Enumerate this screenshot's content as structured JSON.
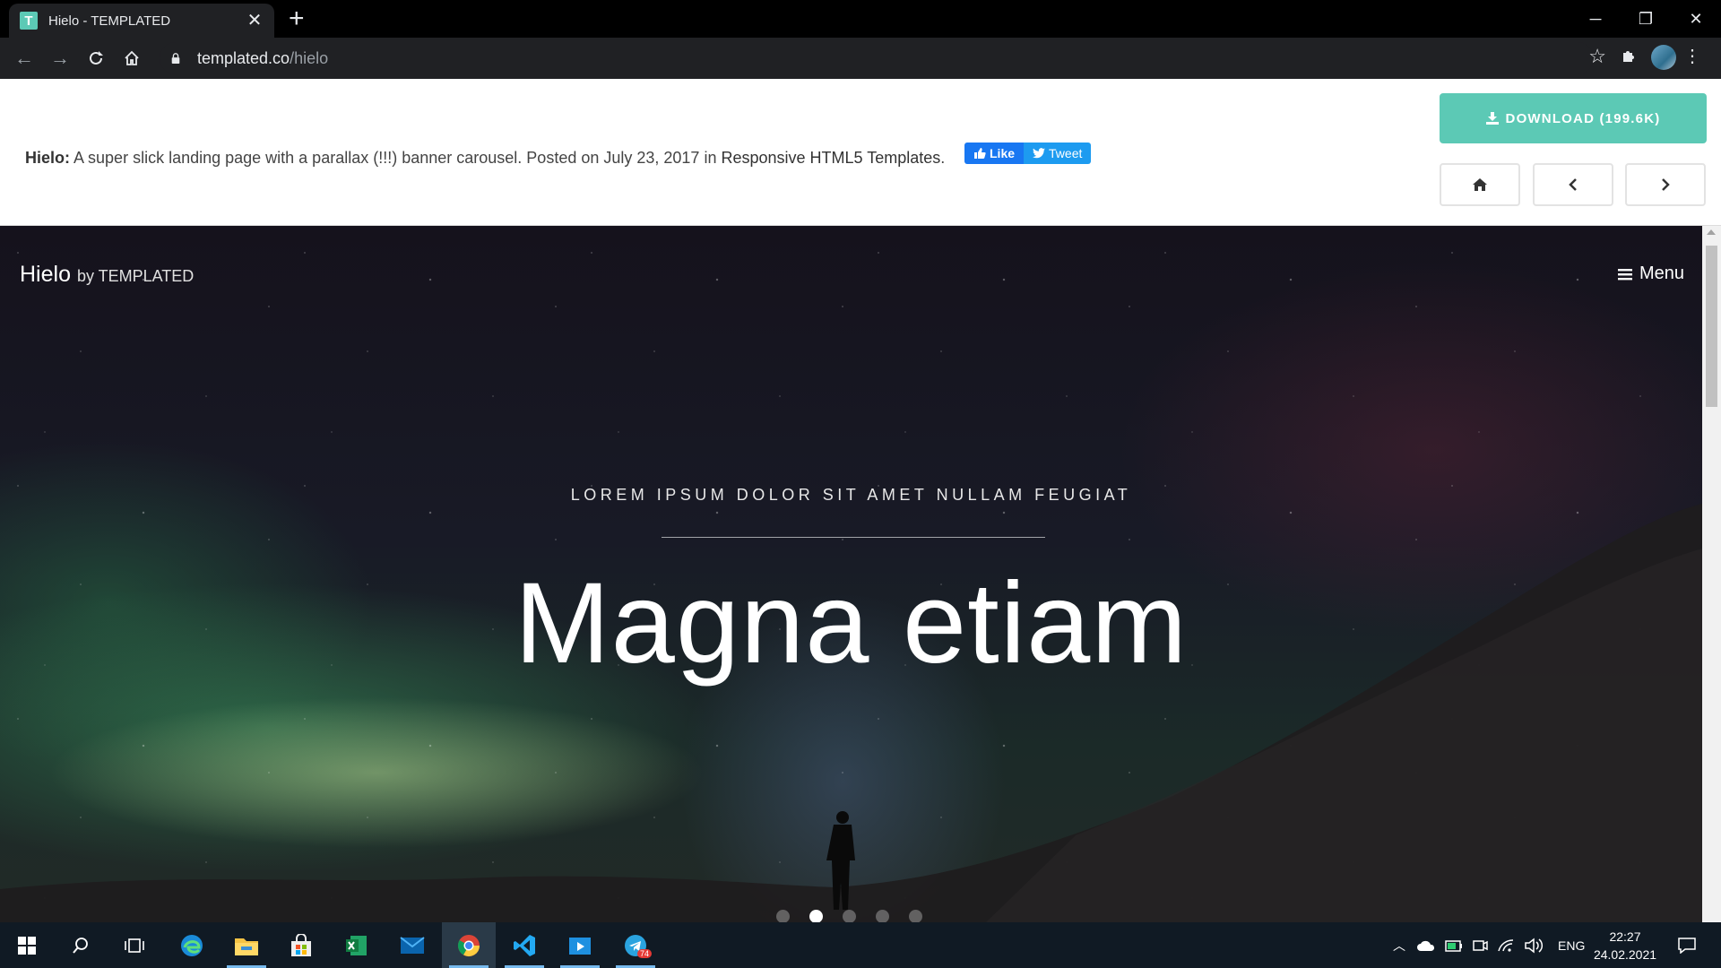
{
  "browser": {
    "tab_title": "Hielo - TEMPLATED",
    "tab_favicon_letter": "T",
    "url_host": "templated.co",
    "url_path": "/hielo"
  },
  "promo": {
    "name": "Hielo:",
    "description": " A super slick landing page with a parallax (!!!) banner carousel. Posted on July 23, 2017 in ",
    "category_link": "Responsive HTML5 Templates",
    "period": ".",
    "like_label": "Like",
    "tweet_label": "Tweet",
    "download_label": "DOWNLOAD (199.6K)"
  },
  "hero": {
    "brand": "Hielo",
    "brand_by": "by TEMPLATED",
    "menu_label": "Menu",
    "subtitle": "LOREM IPSUM DOLOR SIT AMET NULLAM FEUGIAT",
    "title": "Magna etiam",
    "slides_total": 5,
    "active_slide": 2
  },
  "taskbar": {
    "language": "ENG",
    "time": "22:27",
    "date": "24.02.2021",
    "telegram_badge": "74"
  },
  "colors": {
    "accent": "#5cc9b5",
    "facebook": "#1877f2",
    "twitter": "#1d9bf0",
    "taskbar": "#101a24"
  }
}
